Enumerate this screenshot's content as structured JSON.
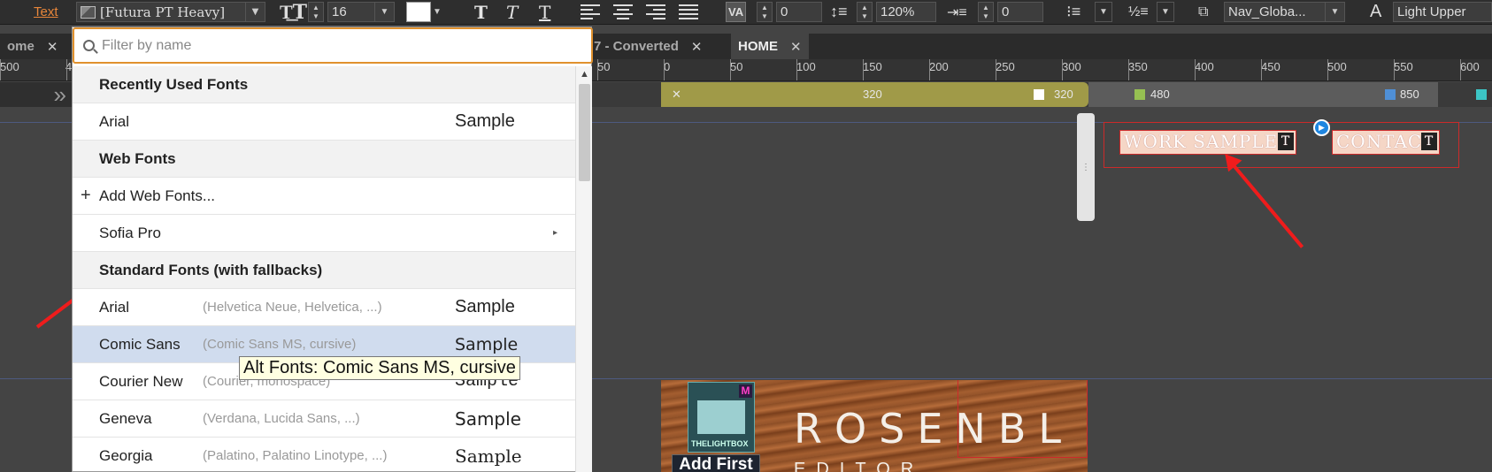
{
  "toolbar": {
    "text_label": "Text",
    "font_family": "[Futura PT Heavy]",
    "font_size": "16",
    "tracking": "0",
    "line_height": "120%",
    "indent": "0",
    "va_label": "VA",
    "paragraph_style": "Nav_Globa...",
    "text_case": "Light Upper",
    "fill_color": "#ffffff"
  },
  "tabs": [
    {
      "label": "ome",
      "close": "✕"
    },
    {
      "label": "7 - Converted",
      "close": "✕"
    },
    {
      "label": "HOME",
      "close": "✕"
    }
  ],
  "ruler": {
    "labels": [
      "500",
      "4",
      "50",
      "0",
      "50",
      "100",
      "150",
      "200",
      "250",
      "300",
      "350",
      "400",
      "450",
      "500",
      "550",
      "600"
    ]
  },
  "breakpoints": {
    "main_center": "320",
    "main_handle": "320",
    "bp2": "480",
    "bp3": "850",
    "close": "✕",
    "colors": {
      "olive": "#a09a48",
      "green": "#96c052",
      "blue": "#4f8fd6",
      "teal": "#3cc5c5"
    }
  },
  "canvas": {
    "nav_items": [
      "WORK SAMPLES",
      "CONTACT"
    ],
    "hero_title": "ROSENBL",
    "hero_sub": "EDITOR",
    "lightbox_label": "THELIGHTBOX",
    "lightbox_badge": "M",
    "add_first": "Add First"
  },
  "font_menu": {
    "filter_placeholder": "Filter by name",
    "rows": [
      {
        "type": "header",
        "label": "Recently Used Fonts"
      },
      {
        "type": "font",
        "label": "Arial",
        "alt": "",
        "sample": "Sample"
      },
      {
        "type": "header",
        "label": "Web Fonts"
      },
      {
        "type": "action",
        "label": "Add Web Fonts...",
        "icon": "+"
      },
      {
        "type": "submenu",
        "label": "Sofia Pro",
        "icon": "▸"
      },
      {
        "type": "header",
        "label": "Standard Fonts (with fallbacks)"
      },
      {
        "type": "font",
        "label": "Arial",
        "alt": "(Helvetica Neue, Helvetica, ...)",
        "sample": "Sample"
      },
      {
        "type": "font",
        "label": "Comic Sans",
        "alt": "(Comic Sans MS, cursive)",
        "sample": "Sample",
        "selected": true
      },
      {
        "type": "font",
        "label": "Courier New",
        "alt": "(Courier, monospace)",
        "sample": "Sample"
      },
      {
        "type": "font",
        "label": "Geneva",
        "alt": "(Verdana, Lucida Sans, ...)",
        "sample": "Sample"
      },
      {
        "type": "font",
        "label": "Georgia",
        "alt": "(Palatino, Palatino Linotype, ...)",
        "sample": "Sample"
      }
    ],
    "tooltip": "Alt Fonts: Comic Sans MS, cursive"
  }
}
